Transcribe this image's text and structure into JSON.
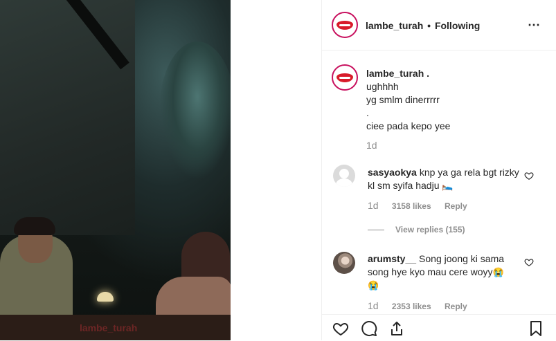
{
  "post": {
    "username": "lambe_turah",
    "follow_status": "Following",
    "separator": "•",
    "more_icon": "⋯",
    "media_watermark": "lambe_turah"
  },
  "caption": {
    "username": "lambe_turah .",
    "text": "ughhhh\nyg smlm dinerrrrr\n.\nciee pada kepo yee",
    "time": "1d"
  },
  "comments": [
    {
      "username": "sasyaokya",
      "text": "knp ya ga rela bgt rizky kl sm syifa hadju",
      "emoji": "🛌",
      "time": "1d",
      "likes": "3158 likes",
      "reply": "Reply",
      "view_replies": "View replies (155)"
    },
    {
      "username": "arumsty__",
      "text": "Song joong ki sama song hye kyo mau cere woyy",
      "emoji": "😭",
      "emoji2": "😭",
      "time": "1d",
      "likes": "2353 likes",
      "reply": "Reply"
    }
  ],
  "icons": [
    "heart-icon",
    "comment-icon",
    "share-icon",
    "bookmark-icon",
    "more-options-icon"
  ],
  "colors": {
    "text": "#262626",
    "muted": "#8e8e8e",
    "border": "#efefef",
    "ring": "#c8105e",
    "lips": "#d81b2a"
  }
}
